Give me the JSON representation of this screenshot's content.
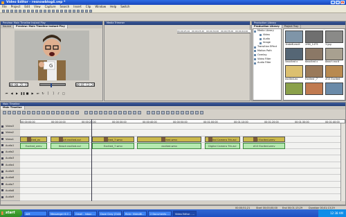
{
  "window": {
    "title": "Video Editor - resnowblog4.vep *"
  },
  "menu": [
    "File",
    "Project",
    "Edit",
    "View",
    "Capture",
    "Search",
    "Insert",
    "Clip",
    "Window",
    "Help",
    "Switch"
  ],
  "preview": {
    "title": "Preview: Main Timeline Instant Play",
    "tabs": [
      "Source",
      "Preview: Main Timeline Instant Play"
    ],
    "timecode_left": "00;00;25;15",
    "timecode_right": "00;01;13;29",
    "scrub_position": 0.42
  },
  "trimmer": {
    "title": "Media Trimmer",
    "ruler_labels": [
      "00;00;25;10",
      "00;00;25;20",
      "00;00;30;00",
      "00;00;35;00",
      "00;00;40;00"
    ]
  },
  "library": {
    "title": "Production Library",
    "tabs": [
      "Production Library",
      "Project Tray"
    ],
    "tree": [
      {
        "label": "Media Library",
        "level": 0
      },
      {
        "label": "Video",
        "level": 1
      },
      {
        "label": "Audio",
        "level": 1
      },
      {
        "label": "Image",
        "level": 1
      },
      {
        "label": "Transition Effect",
        "level": 0
      },
      {
        "label": "Motion Path",
        "level": 0
      },
      {
        "label": "Overlay",
        "level": 0
      },
      {
        "label": "Video Filter",
        "level": 0
      },
      {
        "label": "Audio Filter",
        "level": 0
      }
    ],
    "thumbnails": [
      {
        "caption": "1take6-excit",
        "color": "#7f95a8"
      },
      {
        "caption": "2f60_1475",
        "color": "#6f6f6f"
      },
      {
        "caption": "3.jpg",
        "color": "#8a8a88"
      },
      {
        "caption": "5excited x",
        "color": "#556675"
      },
      {
        "caption": "6excited x",
        "color": "#8b7866"
      },
      {
        "caption": "8each excit",
        "color": "#a8a090"
      },
      {
        "caption": "excited-ex",
        "color": "#dcc070"
      },
      {
        "caption": "Excited _7",
        "color": "#9a7a5a"
      },
      {
        "caption": "#10 Excited",
        "color": "#b88a50"
      },
      {
        "caption": "",
        "color": "#8aa04a"
      },
      {
        "caption": "",
        "color": "#c07a50"
      },
      {
        "caption": "",
        "color": "#6a8aa8"
      }
    ]
  },
  "timeline": {
    "title": "Main Timeline",
    "tab": "Main Timeline",
    "ruler_labels": [
      "00;00;00;00",
      "00;00;10;00",
      "00;00;20;00",
      "00;00;30;00",
      "00;00;40;00",
      "00;00;50;00",
      "00;01;00;00",
      "00;01;10;00",
      "00;01;20;00",
      "00;01;30;00",
      "00;01;40;00"
    ],
    "track_labels": [
      "Video3",
      "Video2",
      "Video1",
      "Audio1",
      "Audio2",
      "Audio3",
      "Audio4",
      "Audio5",
      "Audio6",
      "Audio7",
      "Audio8",
      "Audio9"
    ],
    "video_clips": [
      {
        "label": "excited_ex",
        "start": 0.0,
        "width": 0.085
      },
      {
        "label": "6each excited.avi",
        "start": 0.095,
        "width": 0.12
      },
      {
        "label": "Excited_7.wmv",
        "start": 0.225,
        "width": 0.13
      },
      {
        "label": "excited.wmv",
        "start": 0.365,
        "width": 0.2
      },
      {
        "label": "Digital Camera 7th.avi",
        "start": 0.575,
        "width": 0.11
      },
      {
        "label": "#10 Excited.wmv",
        "start": 0.695,
        "width": 0.13
      }
    ],
    "audio_clips": [
      {
        "label": "Excited_wmv",
        "start": 0.0,
        "width": 0.085
      },
      {
        "label": "6each excited.avi",
        "start": 0.095,
        "width": 0.12
      },
      {
        "label": "Excited_7.wmv",
        "start": 0.225,
        "width": 0.13
      },
      {
        "label": "excited.wmv",
        "start": 0.365,
        "width": 0.2
      },
      {
        "label": "Digital Camera 7th.avi",
        "start": 0.575,
        "width": 0.11
      },
      {
        "label": "#10 Excited.wmv",
        "start": 0.695,
        "width": 0.13
      }
    ]
  },
  "status": {
    "left": "00;00;51;21",
    "start": "Start 00;00;00;00",
    "end": "End 00;01;13;29",
    "duration": "Duration 00;01;13;29"
  },
  "taskbar": {
    "start": "start",
    "items": [
      "AIM",
      "Messenger 6.0 ...",
      "Gmail - Inbox ...",
      "Dave Gray (Online...",
      "flickr: VideoBl...",
      "2 Documents ...",
      "Video Editor - ..."
    ],
    "clock": "12:38 AM"
  }
}
